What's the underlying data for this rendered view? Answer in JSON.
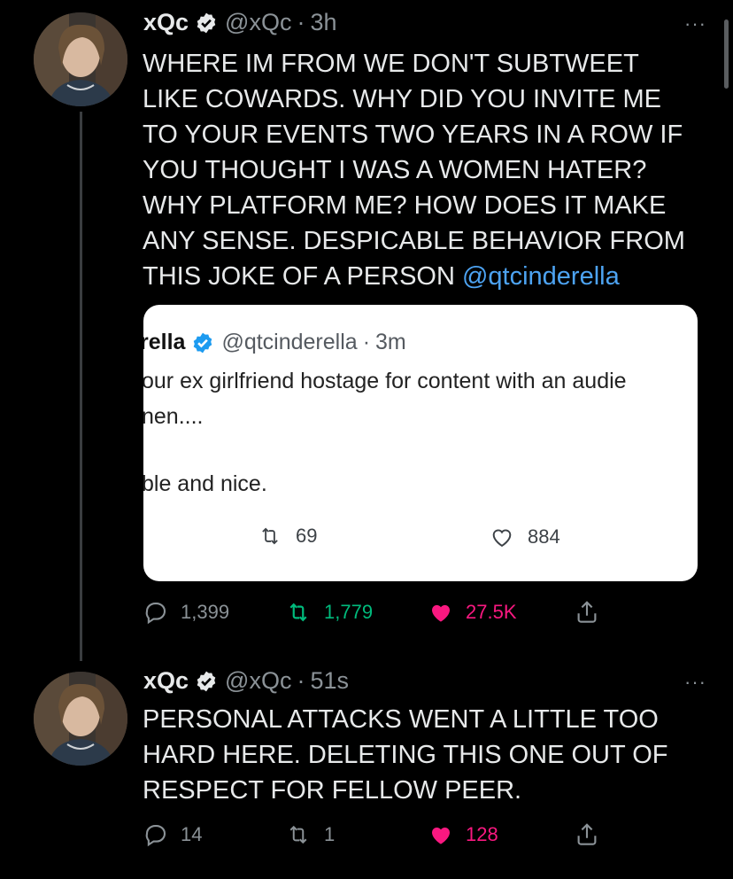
{
  "tweets": [
    {
      "author": {
        "name": "xQc",
        "handle": "@xQc"
      },
      "dot": "·",
      "time": "3h",
      "more": "···",
      "text_lines": [
        "WHERE IM FROM WE DON'T SUBTWEET",
        "LIKE COWARDS. WHY DID YOU INVITE ME",
        "TO YOUR EVENTS TWO YEARS IN A ROW IF",
        "YOU THOUGHT I WAS A WOMEN HATER?",
        "WHY PLATFORM ME? HOW DOES IT MAKE",
        "ANY SENSE. DESPICABLE BEHAVIOR FROM",
        "THIS JOKE OF A PERSON"
      ],
      "mention": "@qtcinderella",
      "quote": {
        "name": "rella",
        "handle": "@qtcinderella",
        "dot": "·",
        "time": "3m",
        "lines": [
          "our ex girlfriend hostage for content with an audie",
          "nen....",
          "ble and nice."
        ],
        "retweets": "69",
        "likes": "884"
      },
      "stats": {
        "replies": "1,399",
        "retweets": "1,779",
        "likes": "27.5K"
      }
    },
    {
      "author": {
        "name": "xQc",
        "handle": "@xQc"
      },
      "dot": "·",
      "time": "51s",
      "more": "···",
      "text_lines": [
        "PERSONAL ATTACKS WENT A LITTLE TOO",
        "HARD HERE. DELETING THIS ONE OUT OF",
        "RESPECT FOR FELLOW PEER."
      ],
      "stats": {
        "replies": "14",
        "retweets": "1",
        "likes": "128"
      }
    }
  ],
  "colors": {
    "background": "#000000",
    "mention": "#4da3f2",
    "verified": "#1d9bf0",
    "like": "#f91880",
    "retweet": "#00ba7c"
  },
  "icons": [
    "verified-badge-icon",
    "reply-icon",
    "retweet-icon",
    "like-icon",
    "share-icon",
    "more-icon"
  ]
}
